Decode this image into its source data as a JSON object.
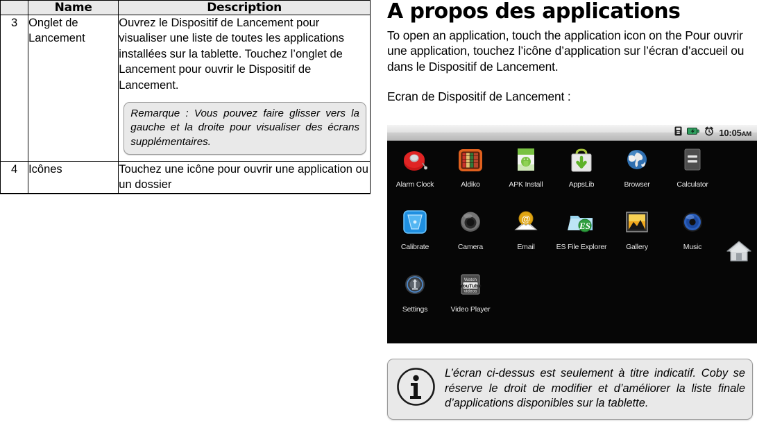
{
  "table": {
    "headers": [
      "",
      "Name",
      "Description"
    ],
    "rows": [
      {
        "num": "3",
        "name": "Onglet de Lancement",
        "desc": "Ouvrez le Dispositif de Lancement pour visualiser une liste de toutes les applications installées sur la tablette. Touchez l’onglet de Lancement pour ouvrir le Dispositif de Lancement.",
        "note": "Remarque : Vous pouvez faire glisser vers la gauche et la droite pour visualiser des écrans supplémentaires."
      },
      {
        "num": "4",
        "name": "Icônes",
        "desc": "Touchez une icône pour ouvrir une application ou un dossier",
        "note": ""
      }
    ]
  },
  "right": {
    "title": "A propos des applications",
    "paragraph1": "To open an application, touch the application icon on the Pour ouvrir une application, touchez l’icône d’application sur l’écran d’accueil ou dans le Dispositif de Lancement.",
    "paragraph2": "Ecran de Dispositif de Lancement :"
  },
  "tablet": {
    "status_bar": {
      "sd_icon": "sd-card-icon",
      "battery_icon": "battery-icon",
      "battery_color": "#2f9e5e",
      "alarm_icon": "alarm-clock-icon",
      "time": "10:05",
      "ampm": "AM"
    },
    "home_icon": "home-icon",
    "background": "#060606",
    "apps": [
      [
        {
          "label": "Alarm Clock",
          "icon": "alarm-clock-app-icon",
          "color": "#cf1f1f"
        },
        {
          "label": "Aldiko",
          "icon": "aldiko-books-icon",
          "color": "#e0601e"
        },
        {
          "label": "APK Install",
          "icon": "apk-install-icon",
          "color": "#79c143"
        },
        {
          "label": "AppsLib",
          "icon": "appslib-bag-icon",
          "color": "#9fc93c"
        },
        {
          "label": "Browser",
          "icon": "browser-globe-icon",
          "color": "#2a6fb5"
        },
        {
          "label": "Calculator",
          "icon": "calculator-icon",
          "color": "#565656"
        }
      ],
      [
        {
          "label": "Calibrate",
          "icon": "calibrate-icon",
          "color": "#3aa6f0"
        },
        {
          "label": "Camera",
          "icon": "camera-icon",
          "color": "#4a4a4a"
        },
        {
          "label": "Email",
          "icon": "email-envelope-icon",
          "color": "#e3a91a"
        },
        {
          "label": "ES File Explorer",
          "icon": "es-file-explorer-icon",
          "color": "#6ec3e8"
        },
        {
          "label": "Gallery",
          "icon": "gallery-icon",
          "color": "#e8a317"
        },
        {
          "label": "Music",
          "icon": "music-speaker-icon",
          "color": "#2a5fbd"
        }
      ],
      [
        {
          "label": "Settings",
          "icon": "settings-icon",
          "color": "#6f7a86"
        },
        {
          "label": "Video Player",
          "icon": "video-player-youtube-icon",
          "color": "#8c8c8c"
        }
      ]
    ]
  },
  "info_callout": {
    "icon": "info-circle-icon",
    "text": "L’écran ci-dessus est seulement à titre indicatif. Coby se réserve le droit de modifier et d’améliorer la liste finale d’applications disponibles sur la tablette."
  }
}
